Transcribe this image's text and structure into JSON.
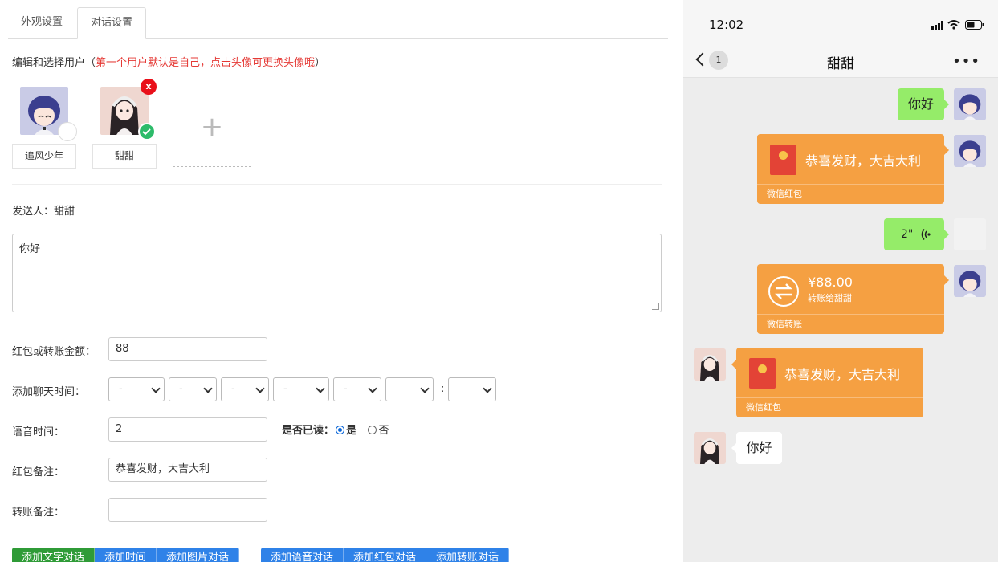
{
  "tabs": [
    "外观设置",
    "对话设置"
  ],
  "hint": {
    "prefix": "编辑和选择用户（",
    "red": "第一个用户默认是自己，点击头像可更换头像哦",
    "suffix": "）"
  },
  "users": [
    {
      "name": "追风少年",
      "selected": false
    },
    {
      "name": "甜甜",
      "selected": true,
      "delete_label": "x"
    }
  ],
  "add_user_symbol": "+",
  "sender": {
    "label": "发送人：",
    "name": "甜甜"
  },
  "message_text": "你好",
  "form": {
    "amount_label": "红包或转账金额：",
    "amount_value": "88",
    "time_label": "添加聊天时间：",
    "time_selects": [
      "-",
      "-",
      "-",
      "-",
      "-",
      "",
      ""
    ],
    "time_colon": ":",
    "voice_label": "语音时间：",
    "voice_value": "2",
    "read_label": "是否已读：",
    "read_yes": "是",
    "read_no": "否",
    "read_selected": "是",
    "redpacket_note_label": "红包备注：",
    "redpacket_note_value": "恭喜发财，大吉大利",
    "transfer_note_label": "转账备注：",
    "transfer_note_value": ""
  },
  "buttons_group1": [
    "添加文字对话",
    "添加时间",
    "添加图片对话"
  ],
  "buttons_group2": [
    "添加语音对话",
    "添加红包对话",
    "添加转账对话"
  ],
  "phone": {
    "time": "12:02",
    "unread_count": "1",
    "chat_title": "甜甜",
    "messages": {
      "m1_text": "你好",
      "m2_redpacket_text": "恭喜发财，大吉大利",
      "m2_footer": "微信红包",
      "m3_voice": "2\"",
      "m4_amount": "¥88.00",
      "m4_desc": "转账给甜甜",
      "m4_footer": "微信转账",
      "m5_redpacket_text": "恭喜发财，大吉大利",
      "m5_footer": "微信红包",
      "m6_text": "你好"
    }
  },
  "colors": {
    "accent_green": "#2f9b37",
    "accent_blue": "#2f82e8",
    "bubble_green": "#95ec69",
    "card_orange": "#f5a042",
    "danger_red": "#e9101a"
  }
}
